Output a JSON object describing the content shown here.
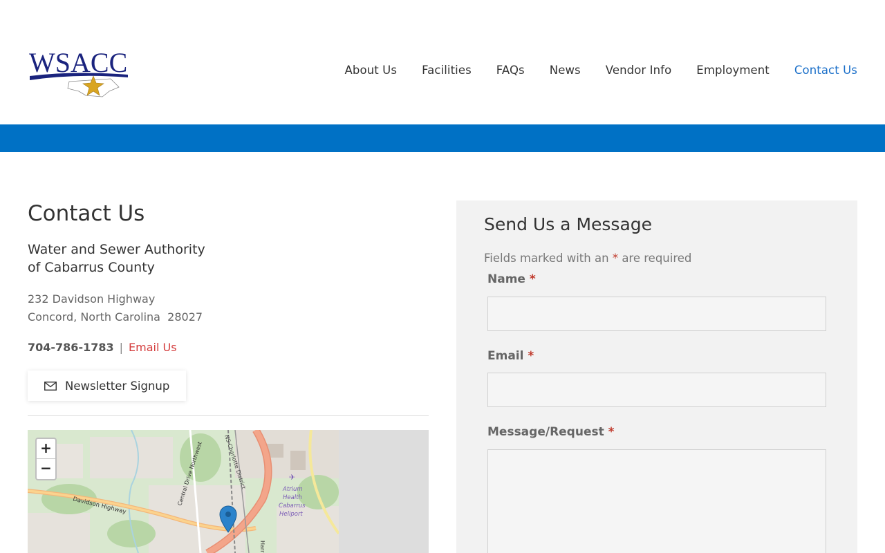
{
  "brand": {
    "logo_text": "WSACC",
    "colors": {
      "primary_blue": "#0071c5",
      "logo_navy": "#1a237e",
      "star_gold": "#d9a521",
      "link_red": "#d43c3c",
      "active_nav": "#1a6fc9"
    }
  },
  "nav": {
    "items": [
      {
        "label": "About Us"
      },
      {
        "label": "Facilities"
      },
      {
        "label": "FAQs"
      },
      {
        "label": "News"
      },
      {
        "label": "Vendor Info"
      },
      {
        "label": "Employment"
      },
      {
        "label": "Contact Us",
        "active": true
      }
    ]
  },
  "contact": {
    "title": "Contact Us",
    "org_line1": "Water and Sewer Authority",
    "org_line2": "of Cabarrus County",
    "address_line1": "232 Davidson Highway",
    "address_line2": "Concord, North Carolina  28027",
    "phone": "704-786-1783",
    "separator": "|",
    "email_label": "Email Us",
    "newsletter_label": "Newsletter Signup",
    "newsletter_icon": "envelope-icon"
  },
  "map": {
    "zoom_in": "+",
    "zoom_out": "−",
    "labels": {
      "road1": "Davidson Highway",
      "road2": "Central Drive Northwest",
      "road3": "NS Charlotte District",
      "heliport": [
        "Atrium",
        "Health",
        "Cabarrus",
        "Heliport"
      ],
      "road4": "Harr"
    },
    "marker_icon": "map-pin-icon"
  },
  "form": {
    "title": "Send Us a Message",
    "required_note_prefix": "Fields marked with an",
    "required_star": "*",
    "required_note_suffix": "are required",
    "fields": [
      {
        "label": "Name",
        "star": "*",
        "value": ""
      },
      {
        "label": "Email",
        "star": "*",
        "value": ""
      },
      {
        "label": "Message/Request",
        "star": "*",
        "value": ""
      }
    ]
  }
}
